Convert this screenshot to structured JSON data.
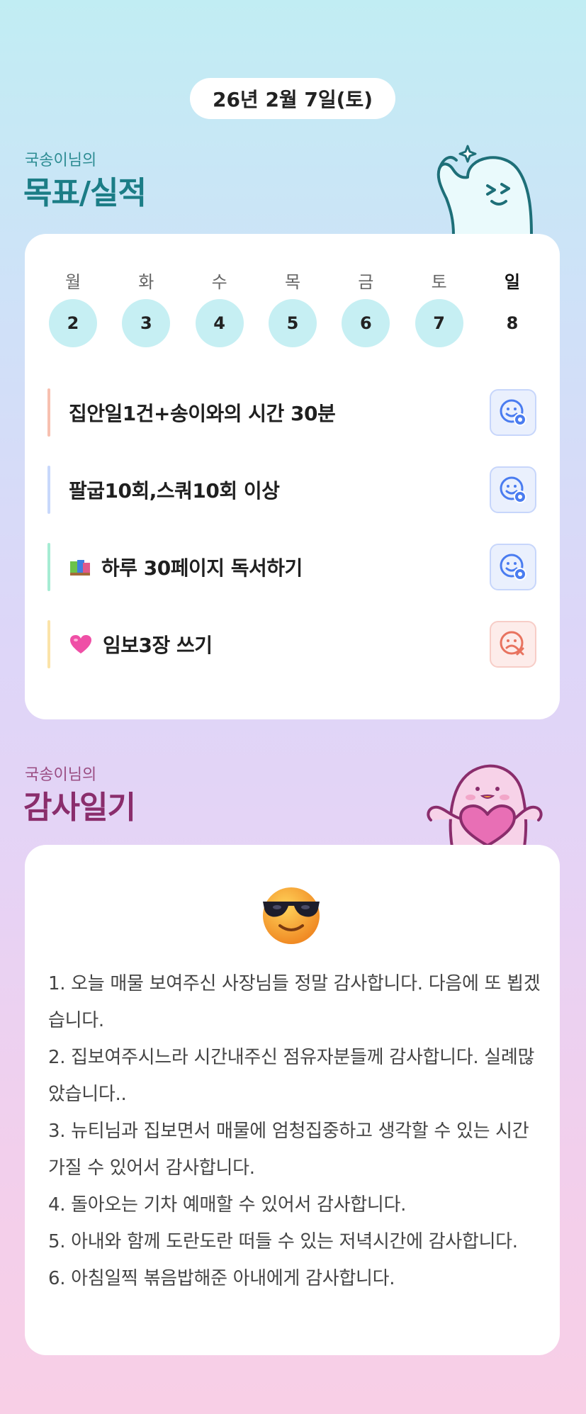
{
  "date_label": "26년 2월 7일(토)",
  "goals_section": {
    "subtitle": "국송이님의",
    "title": "목표/실적"
  },
  "week": {
    "days": [
      {
        "name": "월",
        "num": "2",
        "filled": true
      },
      {
        "name": "화",
        "num": "3",
        "filled": true
      },
      {
        "name": "수",
        "num": "4",
        "filled": true
      },
      {
        "name": "목",
        "num": "5",
        "filled": true
      },
      {
        "name": "금",
        "num": "6",
        "filled": true
      },
      {
        "name": "토",
        "num": "7",
        "filled": true
      },
      {
        "name": "일",
        "num": "8",
        "filled": false
      }
    ]
  },
  "goals": [
    {
      "text": "집안일1건+송이와의 시간 30분",
      "bar_color": "#f7c0b0",
      "status": "done",
      "icon": "smile-check-icon"
    },
    {
      "text": "팔굽10회,스쿼10회 이상",
      "bar_color": "#c8d8fb",
      "status": "done",
      "icon": "smile-check-icon"
    },
    {
      "text": "하루 30페이지 독서하기",
      "bar_color": "#a6ecd3",
      "status": "done",
      "icon": "books-emoji"
    },
    {
      "text": "임보3장 쓰기",
      "bar_color": "#fbe3a8",
      "status": "fail",
      "icon": "pink-heart-emoji"
    }
  ],
  "thanks_section": {
    "subtitle": "국송이님의",
    "title": "감사일기"
  },
  "thanks": {
    "mood_icon": "sunglasses-face-emoji",
    "lines": [
      "1. 오늘 매물 보여주신 사장님들 정말 감사합니다. 다음에 또 뵙겠습니다.",
      "2. 집보여주시느라 시간내주신 점유자분들께 감사합니다. 실례많았습니다..",
      "3. 뉴티님과 집보면서 매물에 엄청집중하고 생각할 수 있는 시간 가질 수 있어서 감사합니다.",
      "4. 돌아오는 기차 예매할 수 있어서 감사합니다.",
      "5. 아내와 함께 도란도란 떠들 수 있는 저녁시간에 감사합니다.",
      "6. 아침일찍 볶음밥해준 아내에게 감사합니다."
    ]
  },
  "colors": {
    "goal_title": "#1b7d86",
    "thanks_title": "#8a2d6c",
    "day_fill": "#c6eff3",
    "done_icon": "#4a7cf0",
    "fail_icon": "#e8735f"
  }
}
